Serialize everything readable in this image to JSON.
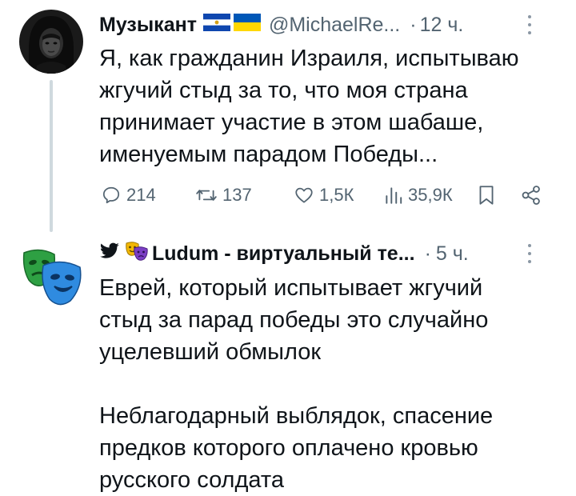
{
  "tweet1": {
    "author_name": "Музыкант",
    "flags": [
      "flag-el-salvador",
      "flag-ukraine"
    ],
    "handle": "@MichaelRe...",
    "separator": "·",
    "time": "12 ч.",
    "text_lines": [
      "Я, как гражданин Израиля, испытываю",
      "жгучий стыд за то, что моя страна",
      "принимает участие в этом шабаше,",
      "именуемым парадом Победы..."
    ],
    "replies": "214",
    "retweets": "137",
    "likes": "1,5К",
    "views": "35,9К"
  },
  "tweet2": {
    "author_prefix_icons": [
      "bird-icon",
      "theater-masks-emoji"
    ],
    "author_name": "Ludum - виртуальный те...",
    "separator": "·",
    "time": "5 ч.",
    "paragraph1_lines": [
      "Еврей, который испытывает жгучий",
      "стыд за парад победы это случайно",
      "уцелевший обмылок"
    ],
    "paragraph2_lines": [
      "Неблагодарный выблядок, спасение",
      "предков которого оплачено кровью",
      "русского солдата"
    ]
  },
  "colors": {
    "text": "#0f1419",
    "muted": "#536471",
    "thread_line": "#cfd9de",
    "blue_mask": "#2f8be0",
    "green_mask": "#2ea043"
  }
}
